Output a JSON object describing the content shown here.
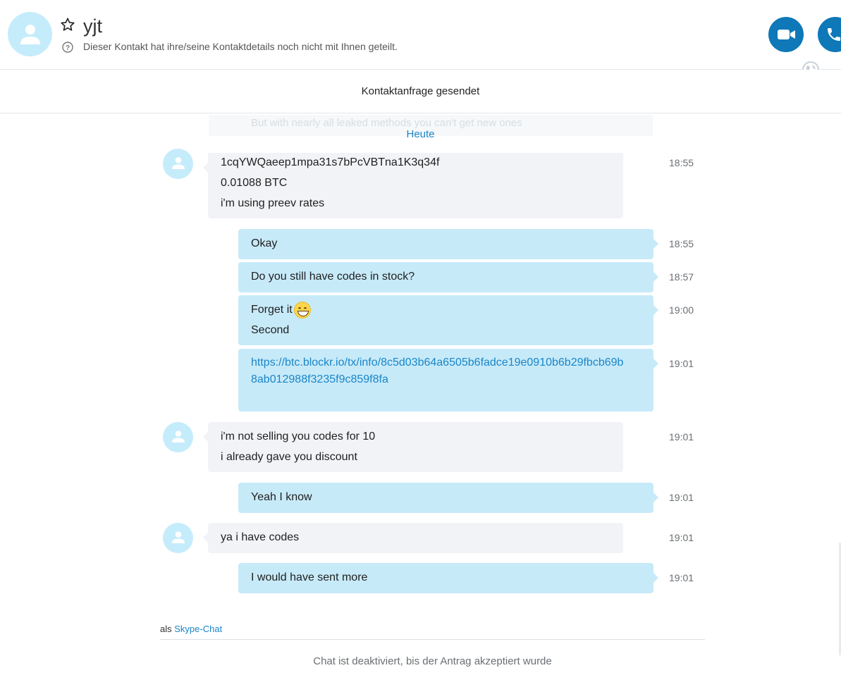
{
  "header": {
    "contact_name": "yjt",
    "subtitle": "Dieser Kontakt hat ihre/seine Kontaktdetails noch nicht mit Ihnen geteilt.",
    "icons": [
      "avatar",
      "star-icon",
      "help-icon",
      "video-call-icon",
      "phone-icon",
      "globe-icon"
    ]
  },
  "request_status": "Kontaktanfrage gesendet",
  "chat": {
    "faded_text": "But with nearly all leaked methods you can't get new ones",
    "date_separator": "Heute",
    "messages": [
      {
        "direction": "in",
        "lines": [
          "1cqYWQaeep1mpa31s7bPcVBTna1K3q34f",
          "0.01088 BTC",
          "i'm using preev rates"
        ],
        "time": "18:55"
      },
      {
        "direction": "out",
        "lines": [
          "Okay"
        ],
        "time": "18:55"
      },
      {
        "direction": "out",
        "lines": [
          "Do you still have codes in stock?"
        ],
        "time": "18:57"
      },
      {
        "direction": "out",
        "lines": [
          "Forget it",
          "Second"
        ],
        "emoji": "grinning-emoji",
        "time": "19:00"
      },
      {
        "direction": "out",
        "link": "https://btc.blockr.io/tx/info/8c5d03b64a6505b6fadce19e0910b6b29fbcb69b8ab012988f3235f9c859f8fa",
        "time": "19:01"
      },
      {
        "direction": "in",
        "lines": [
          "i'm not selling you codes for 10",
          "i already gave you discount"
        ],
        "time": "19:01"
      },
      {
        "direction": "out",
        "lines": [
          "Yeah I know"
        ],
        "time": "19:01"
      },
      {
        "direction": "in",
        "lines": [
          "ya i have codes"
        ],
        "time": "19:01"
      },
      {
        "direction": "out",
        "lines": [
          "I would have sent more"
        ],
        "time": "19:01"
      }
    ]
  },
  "footer": {
    "prefix": "als",
    "link": "Skype-Chat",
    "status": "Chat ist deaktiviert, bis der Antrag akzeptiert wurde"
  },
  "colors": {
    "accent": "#0e78b8",
    "link": "#1a86c8",
    "outgoing_bubble": "#c7eaf9",
    "incoming_bubble": "#f1f3f6",
    "avatar_bg": "#c5ecfb"
  }
}
